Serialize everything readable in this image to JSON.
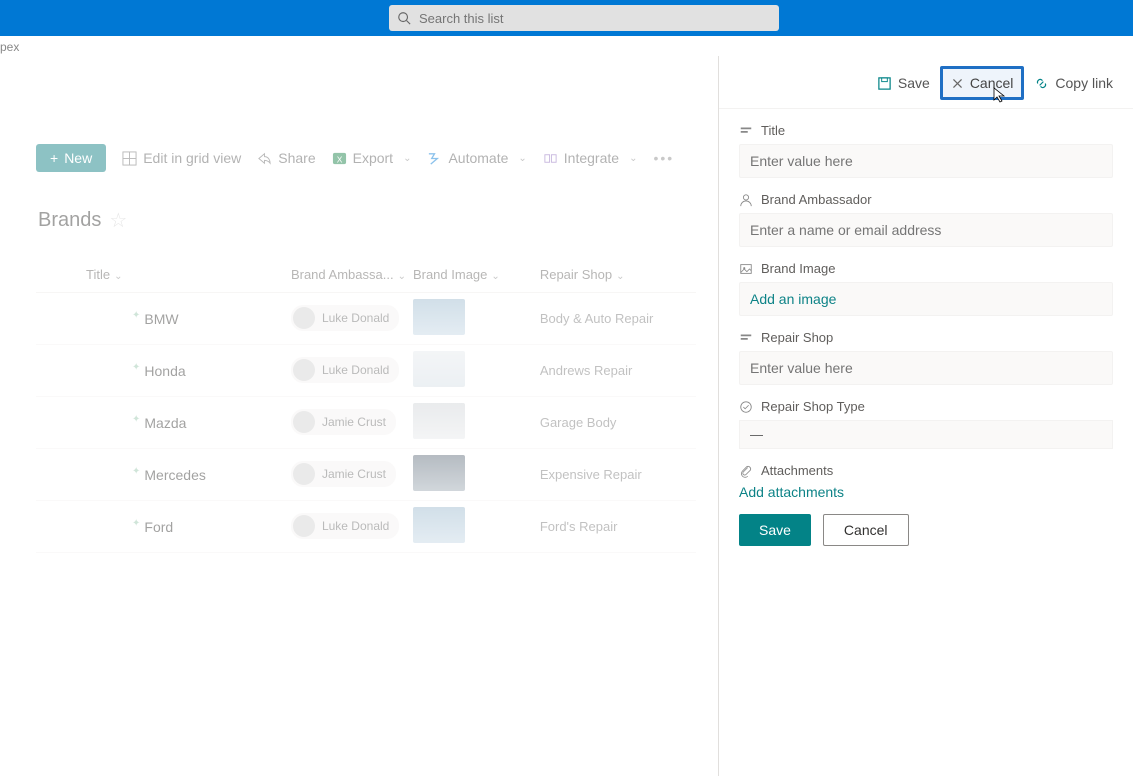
{
  "search": {
    "placeholder": "Search this list"
  },
  "breadcrumb": "pex",
  "toolbar": {
    "new_label": "New",
    "edit_grid": "Edit in grid view",
    "share": "Share",
    "export": "Export",
    "automate": "Automate",
    "integrate": "Integrate"
  },
  "list": {
    "title": "Brands",
    "columns": {
      "title": "Title",
      "ambassador": "Brand Ambassa...",
      "image": "Brand Image",
      "shop": "Repair Shop"
    },
    "rows": [
      {
        "title": "BMW",
        "ambassador": "Luke Donald",
        "shop": "Body & Auto Repair",
        "thumb": "blue"
      },
      {
        "title": "Honda",
        "ambassador": "Luke Donald",
        "shop": "Andrews Repair",
        "thumb": "light"
      },
      {
        "title": "Mazda",
        "ambassador": "Jamie Crust",
        "shop": "Garage Body",
        "thumb": "gray"
      },
      {
        "title": "Mercedes",
        "ambassador": "Jamie Crust",
        "shop": "Expensive Repair",
        "thumb": "dark"
      },
      {
        "title": "Ford",
        "ambassador": "Luke Donald",
        "shop": "Ford's Repair",
        "thumb": "blue"
      }
    ]
  },
  "side": {
    "actions": {
      "save": "Save",
      "cancel": "Cancel",
      "copy": "Copy link"
    },
    "fields": {
      "title_label": "Title",
      "title_placeholder": "Enter value here",
      "amb_label": "Brand Ambassador",
      "amb_placeholder": "Enter a name or email address",
      "img_label": "Brand Image",
      "img_link": "Add an image",
      "shop_label": "Repair Shop",
      "shop_placeholder": "Enter value here",
      "type_label": "Repair Shop Type",
      "type_value": "—",
      "att_label": "Attachments",
      "att_link": "Add attachments"
    },
    "buttons": {
      "save": "Save",
      "cancel": "Cancel"
    }
  }
}
